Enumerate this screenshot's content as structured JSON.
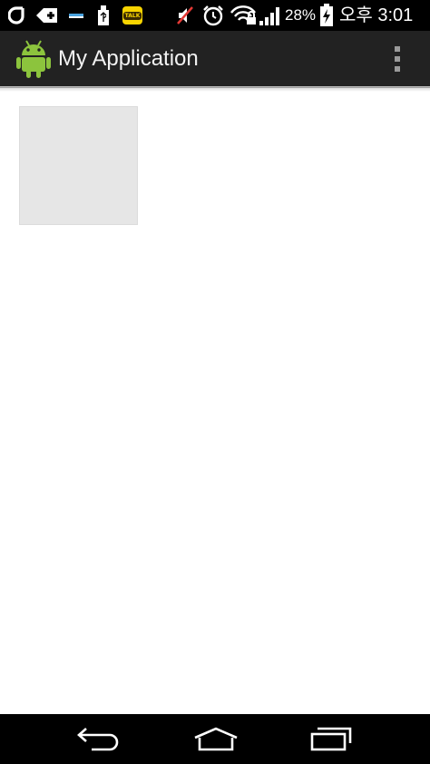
{
  "status_bar": {
    "icons": [
      "olleh-icon",
      "add-box-icon",
      "usb-debug-icon",
      "usb-icon",
      "kakaotalk-icon",
      "mute-icon",
      "alarm-icon",
      "wifi-lock-icon",
      "signal-icon",
      "battery-charging-icon"
    ],
    "kakaotalk_label": "TALK",
    "battery_percent": "28%",
    "time": "오후 3:01"
  },
  "action_bar": {
    "title": "My Application",
    "app_icon": "android-icon",
    "overflow_icon": "overflow-menu-icon"
  },
  "content": {
    "image_placeholder": "image-placeholder"
  },
  "nav_bar": {
    "buttons": [
      "back-icon",
      "home-icon",
      "recents-icon"
    ]
  },
  "colors": {
    "status_bar_bg": "#000000",
    "action_bar_bg": "#222222",
    "content_bg": "#ffffff",
    "placeholder_bg": "#e6e6e6",
    "android_green": "#8cc43d",
    "kakaotalk_yellow": "#f7d400"
  }
}
